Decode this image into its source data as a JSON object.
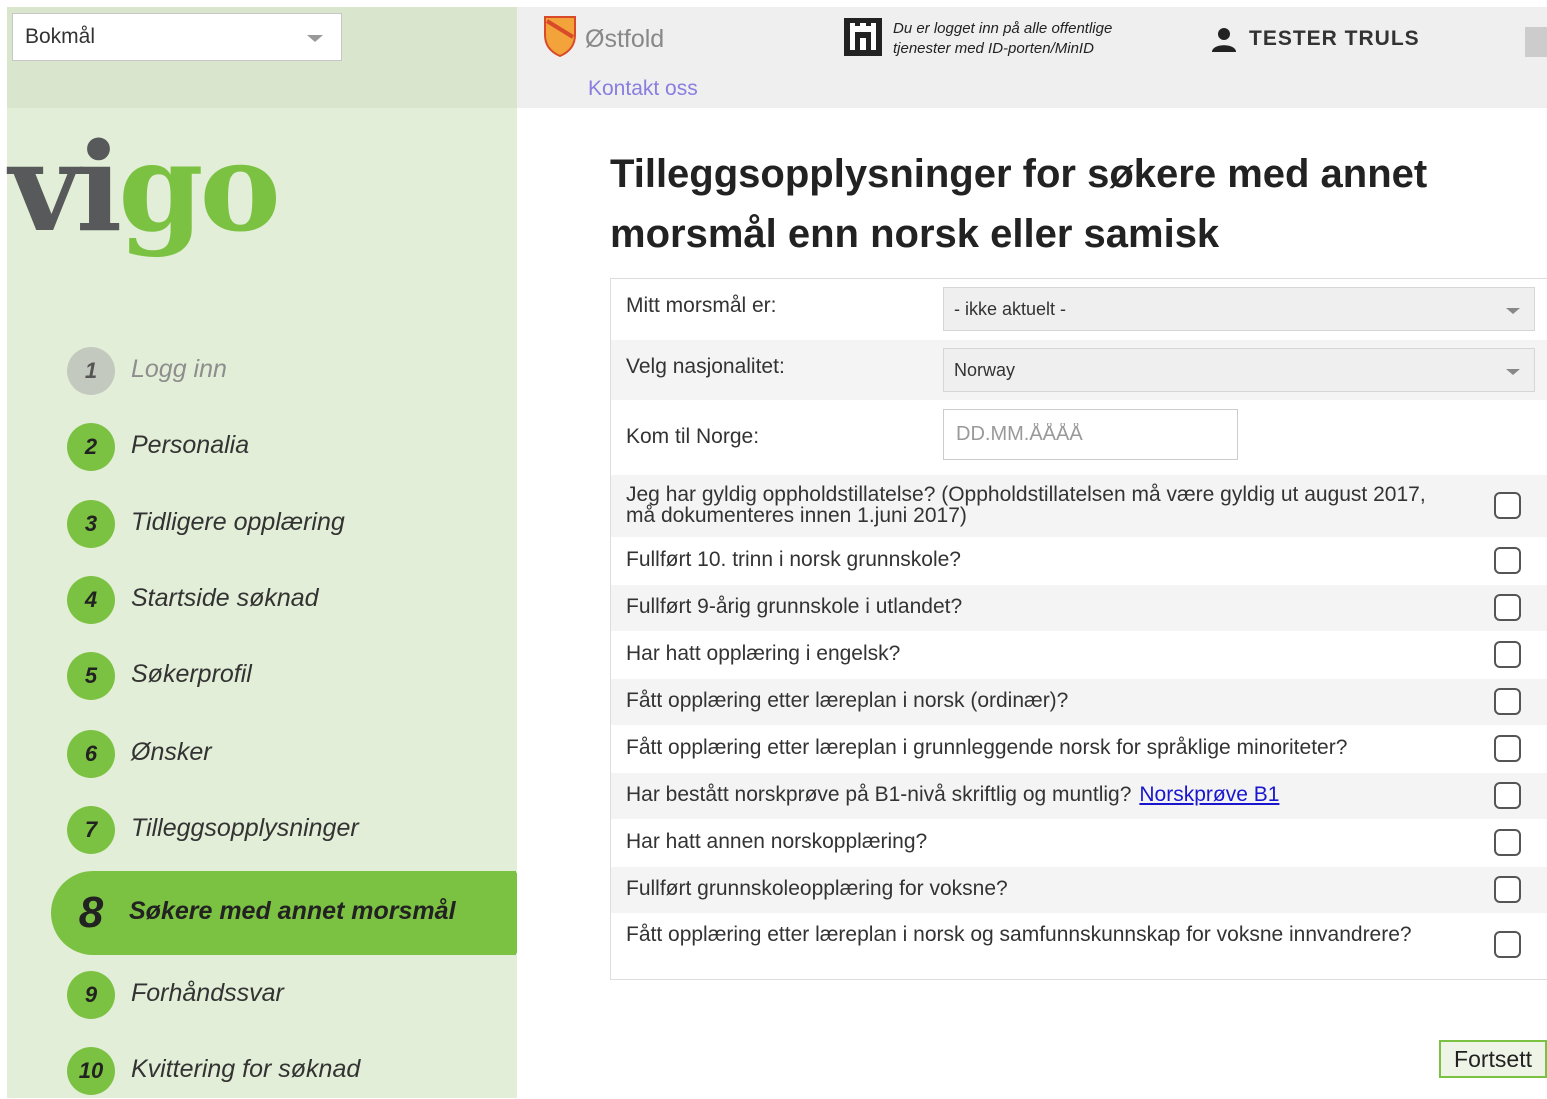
{
  "language_select": {
    "value": "Bokmål"
  },
  "logo": {
    "part1": "vi",
    "part2": "go"
  },
  "steps": [
    {
      "num": "1",
      "label": "Logg inn",
      "state": "done"
    },
    {
      "num": "2",
      "label": "Personalia",
      "state": "todo"
    },
    {
      "num": "3",
      "label": "Tidligere opplæring",
      "state": "todo"
    },
    {
      "num": "4",
      "label": "Startside søknad",
      "state": "todo"
    },
    {
      "num": "5",
      "label": "Søkerprofil",
      "state": "todo"
    },
    {
      "num": "6",
      "label": "Ønsker",
      "state": "todo"
    },
    {
      "num": "7",
      "label": "Tilleggsopplysninger",
      "state": "todo"
    },
    {
      "num": "8",
      "label": "Søkere med annet morsmål",
      "state": "active"
    },
    {
      "num": "9",
      "label": "Forhåndssvar",
      "state": "todo"
    },
    {
      "num": "10",
      "label": "Kvittering for søknad",
      "state": "todo"
    }
  ],
  "header": {
    "county": "Østfold",
    "contact": "Kontakt oss",
    "login_info": "Du er logget inn på alle offentlige tjenester med ID-porten/MinID",
    "user": "TESTER TRULS"
  },
  "page": {
    "title": "Tilleggsopplysninger for søkere med annet morsmål enn norsk eller samisk"
  },
  "form": {
    "mother_tongue": {
      "label": "Mitt morsmål er:",
      "value": "- ikke aktuelt -"
    },
    "nationality": {
      "label": "Velg nasjonalitet:",
      "value": "Norway"
    },
    "arrival": {
      "label": "Kom til Norge:",
      "placeholder": "DD.MM.ÅÅÅÅ"
    },
    "questions": [
      "Jeg har gyldig oppholdstillatelse? (Oppholdstillatelsen må være gyldig ut august 2017, må dokumenteres innen 1.juni 2017)",
      "Fullført 10. trinn i norsk grunnskole?",
      "Fullført 9-årig grunnskole i utlandet?",
      "Har hatt opplæring i engelsk?",
      "Fått opplæring etter læreplan i norsk (ordinær)?",
      "Fått opplæring etter læreplan i grunnleggende norsk for språklige minoriteter?",
      "Har bestått norskprøve på B1-nivå skriftlig og muntlig?",
      "Har hatt annen norskopplæring?",
      "Fullført grunnskoleopplæring for voksne?",
      "Fått opplæring etter læreplan i norsk og samfunnskunnskap for voksne innvandrere?"
    ],
    "b1_link": "Norskprøve B1"
  },
  "actions": {
    "next": "Fortsett"
  },
  "colors": {
    "accent": "#7cc242",
    "sidebar": "#e2eed7",
    "link": "#1a16cf"
  }
}
